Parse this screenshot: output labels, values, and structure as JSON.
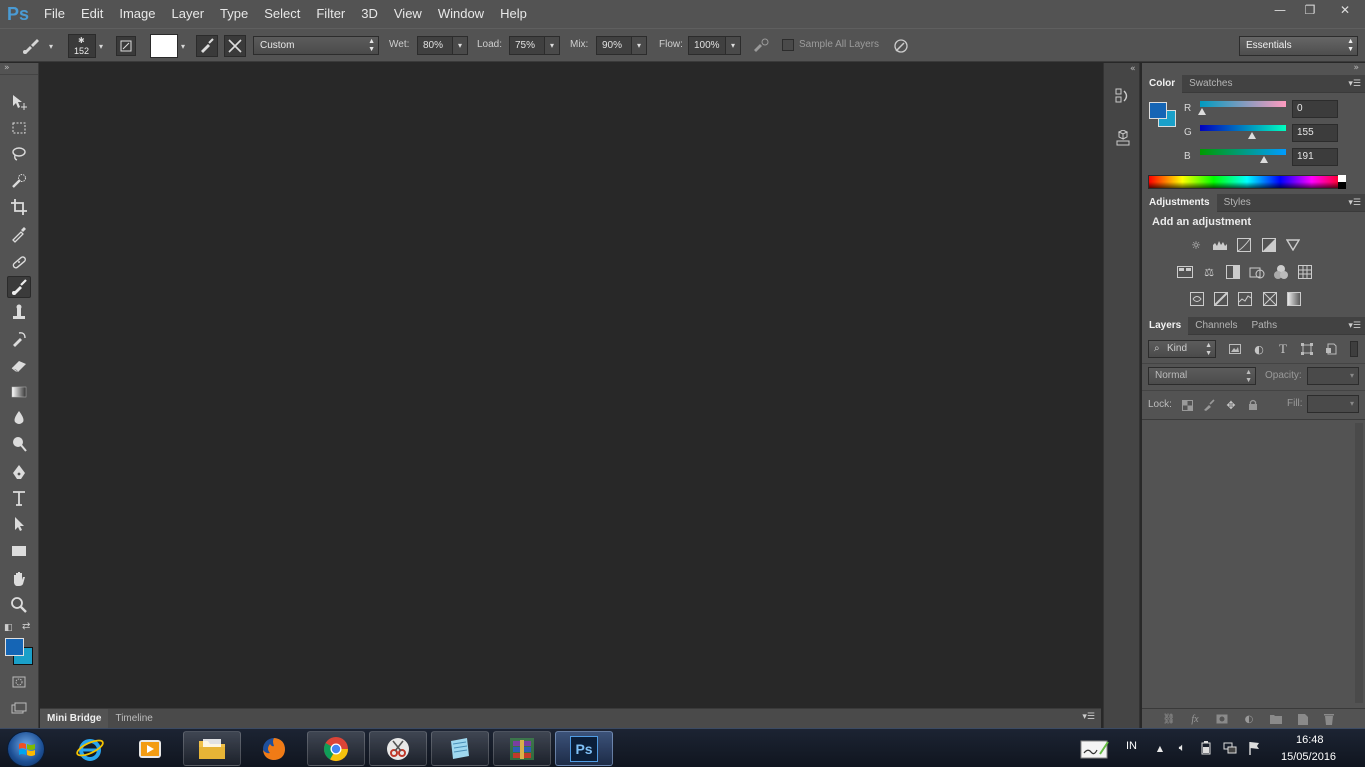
{
  "app": {
    "logo": "Ps"
  },
  "menu": [
    "File",
    "Edit",
    "Image",
    "Layer",
    "Type",
    "Select",
    "Filter",
    "3D",
    "View",
    "Window",
    "Help"
  ],
  "window_controls": {
    "minimize": "—",
    "restore": "❐",
    "close": "✕"
  },
  "options": {
    "brush_size": "152",
    "blend_preset": "Custom",
    "wet_label": "Wet:",
    "wet_value": "80%",
    "load_label": "Load:",
    "load_value": "75%",
    "mix_label": "Mix:",
    "mix_value": "90%",
    "flow_label": "Flow:",
    "flow_value": "100%",
    "sample_all_layers": "Sample All Layers",
    "workspace": "Essentials"
  },
  "bottom_tabs": [
    "Mini Bridge",
    "Timeline"
  ],
  "color_panel": {
    "tabs": [
      "Color",
      "Swatches"
    ],
    "foreground": "#1565b5",
    "background": "#1aa0c9",
    "r_label": "R",
    "r_value": "0",
    "g_label": "G",
    "g_value": "155",
    "b_label": "B",
    "b_value": "191"
  },
  "adjustments_panel": {
    "tabs": [
      "Adjustments",
      "Styles"
    ],
    "heading": "Add an adjustment"
  },
  "layers_panel": {
    "tabs": [
      "Layers",
      "Channels",
      "Paths"
    ],
    "filter_kind": "Kind",
    "blend_mode": "Normal",
    "opacity_label": "Opacity:",
    "lock_label": "Lock:",
    "fill_label": "Fill:"
  },
  "taskbar": {
    "language": "IN",
    "time": "16:48",
    "date": "15/05/2016"
  }
}
